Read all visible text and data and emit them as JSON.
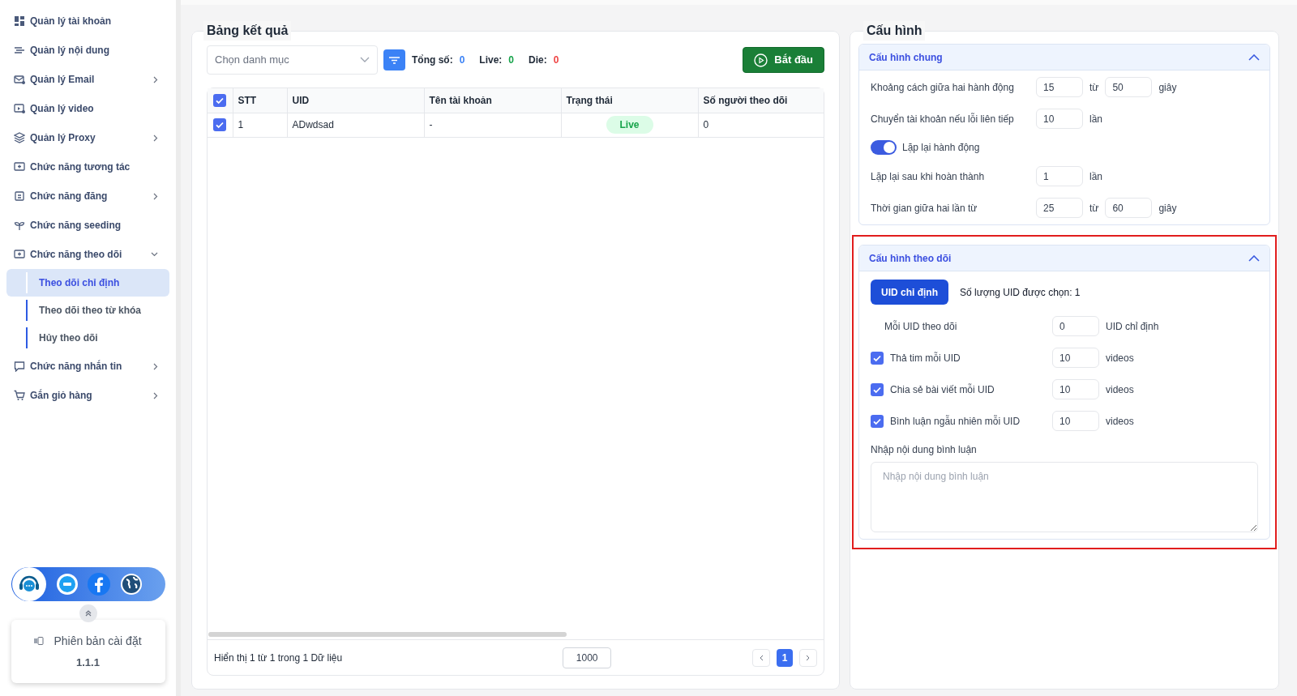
{
  "sidebar": {
    "items": [
      {
        "label": "Quản lý tài khoản"
      },
      {
        "label": "Quản lý nội dung"
      },
      {
        "label": "Quản lý Email",
        "expanded": false
      },
      {
        "label": "Quản lý video"
      },
      {
        "label": "Quản lý Proxy",
        "expanded": false
      },
      {
        "label": "Chức năng tương tác"
      },
      {
        "label": "Chức năng đăng",
        "expanded": false
      },
      {
        "label": "Chức năng seeding"
      },
      {
        "label": "Chức năng theo dõi",
        "expanded": true,
        "children": [
          {
            "label": "Theo dõi chỉ định",
            "selected": true
          },
          {
            "label": "Theo dõi theo từ khóa",
            "selected": false
          },
          {
            "label": "Hủy theo dõi",
            "selected": false
          }
        ]
      },
      {
        "label": "Chức năng nhắn tin",
        "expanded": false
      },
      {
        "label": "Gắn giỏ hàng",
        "expanded": false
      }
    ],
    "version": {
      "label": "Phiên bản cài đặt",
      "value": "1.1.1"
    }
  },
  "results": {
    "title": "Bảng kết quả",
    "category_select": {
      "placeholder": "Chọn danh mục"
    },
    "stats": [
      {
        "label": "Tổng số:",
        "value": "0",
        "color": "#3b82f6"
      },
      {
        "label": "Live:",
        "value": "0",
        "color": "#16a34a"
      },
      {
        "label": "Die:",
        "value": "0",
        "color": "#ef4444"
      }
    ],
    "start_button": "Bắt đầu",
    "table": {
      "all_checked": true,
      "columns": [
        "STT",
        "UID",
        "Tên tài khoản",
        "Trạng thái",
        "Số người theo dõi"
      ],
      "rows": [
        {
          "checked": true,
          "cells": [
            "1",
            "ADwdsad",
            "-",
            "Live",
            "0"
          ]
        }
      ]
    },
    "footer": {
      "summary": "Hiển thị 1 từ 1 trong 1 Dữ liệu",
      "page_size": "1000",
      "pages": [
        {
          "label": "1",
          "selected": true
        }
      ]
    }
  },
  "config": {
    "title": "Cấu hình",
    "sections": [
      {
        "title": "Cấu hình chung",
        "expanded": true,
        "highlighted": false,
        "rows": [
          {
            "kind": "range",
            "label": "Khoảng cách giữa hai hành động",
            "from": "15",
            "separator": "từ",
            "to": "50",
            "unit": "giây"
          },
          {
            "kind": "single",
            "label": "Chuyển tài khoản nếu lỗi liên tiếp",
            "value": "10",
            "unit": "lần"
          },
          {
            "kind": "toggle",
            "label": "Lặp lại hành động",
            "on": true
          },
          {
            "kind": "single",
            "label": "Lặp lại sau khi hoàn thành",
            "value": "1",
            "unit": "lần"
          },
          {
            "kind": "range",
            "label": "Thời gian giữa hai lần từ",
            "from": "25",
            "separator": "từ",
            "to": "60",
            "unit": "giây"
          }
        ]
      },
      {
        "title": "Cấu hình theo dõi",
        "expanded": true,
        "highlighted": true,
        "rows": [
          {
            "kind": "uid",
            "button": "UID chỉ định",
            "count": "Số lượng UID được chọn: 1"
          },
          {
            "kind": "indented",
            "label": "Mỗi UID theo dõi",
            "value": "0",
            "unit": "UID chỉ định"
          },
          {
            "kind": "check",
            "checked": true,
            "label": "Thả tim mỗi UID",
            "value": "10",
            "unit": "videos"
          },
          {
            "kind": "check",
            "checked": true,
            "label": "Chia sẻ bài viết mỗi UID",
            "value": "10",
            "unit": "videos"
          },
          {
            "kind": "check",
            "checked": true,
            "label": "Bình luận ngẫu nhiên mỗi UID",
            "value": "10",
            "unit": "videos"
          },
          {
            "kind": "textarea",
            "label": "Nhập nội dung bình luận",
            "placeholder": "Nhập nội dung bình luận"
          }
        ]
      }
    ]
  }
}
